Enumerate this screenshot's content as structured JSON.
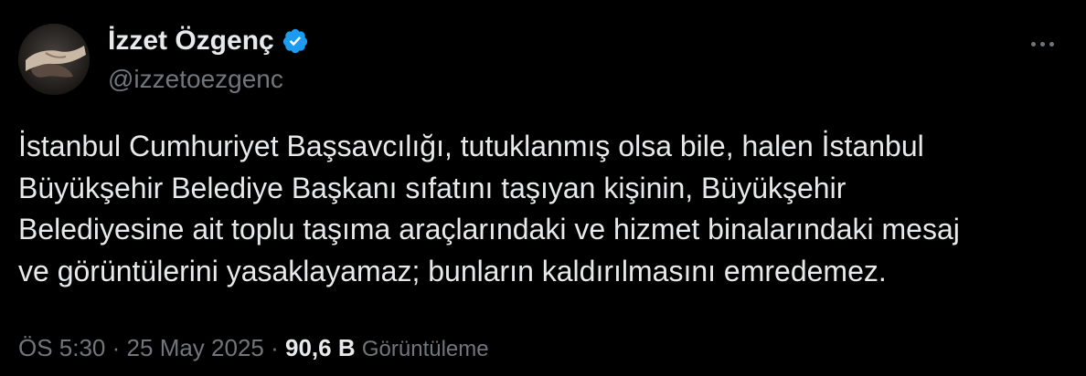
{
  "author": {
    "display_name": "İzzet Özgenç",
    "handle": "@izzetoezgenc",
    "verified": true,
    "verified_color": "#1d9bf0"
  },
  "tweet": {
    "text_lines": [
      "İstanbul Cumhuriyet Başsavcılığı, tutuklanmış olsa bile, halen İstanbul",
      "Büyükşehir Belediye Başkanı sıfatını taşıyan kişinin, Büyükşehir",
      "Belediyesine ait toplu taşıma araçlarındaki ve hizmet binalarındaki mesaj",
      "ve görüntülerini yasaklayamaz; bunların kaldırılmasını emredemez."
    ]
  },
  "meta": {
    "time": "ÖS 5:30",
    "separator": "·",
    "date": "25 May 2025",
    "views_count": "90,6 B",
    "views_label": "Görüntüleme"
  },
  "icons": {
    "more": "more-horizontal-icon",
    "verified": "verified-badge-icon"
  },
  "colors": {
    "background": "#000000",
    "primary_text": "#e7e9ea",
    "secondary_text": "#71767b"
  }
}
